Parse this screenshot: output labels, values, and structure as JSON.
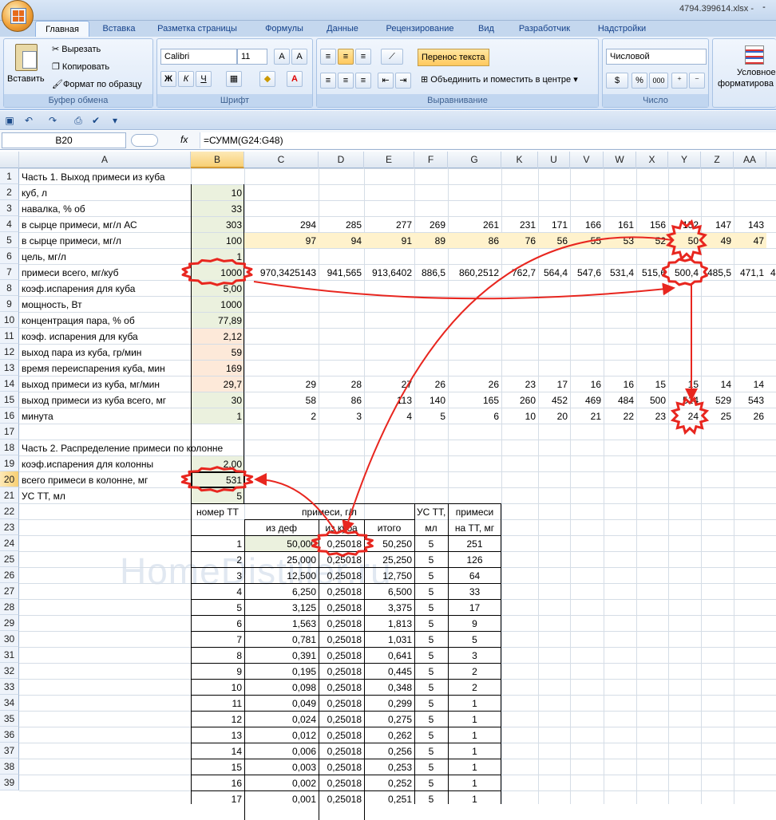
{
  "window": {
    "title": "4794.399614.xlsx - ",
    "min": "-"
  },
  "tabs": [
    "Главная",
    "Вставка",
    "Разметка страницы",
    "Формулы",
    "Данные",
    "Рецензирование",
    "Вид",
    "Разработчик",
    "Надстройки"
  ],
  "ribbon": {
    "paste": "Вставить",
    "cut": "Вырезать",
    "copy": "Копировать",
    "format_painter": "Формат по образцу",
    "clipboard_label": "Буфер обмена",
    "font_name": "Calibri",
    "font_size": "11",
    "bold": "Ж",
    "italic": "К",
    "underline": "Ч",
    "font_label": "Шрифт",
    "wrap_text": "Перенос текста",
    "merge_center": "Объединить и поместить в центре",
    "align_label": "Выравнивание",
    "number_format": "Числовой",
    "percent": "%",
    "thousands": "000",
    "number_label": "Число",
    "cond_format": "Условное",
    "cond_format2": "форматирова"
  },
  "formula_bar": {
    "name_box": "B20",
    "fx": "fx",
    "formula": "=СУММ(G24:G48)"
  },
  "columns": [
    "A",
    "B",
    "C",
    "D",
    "E",
    "F",
    "G",
    "K",
    "U",
    "V",
    "W",
    "X",
    "Y",
    "Z",
    "AA"
  ],
  "rows": [
    "1",
    "2",
    "3",
    "4",
    "5",
    "6",
    "7",
    "8",
    "9",
    "10",
    "11",
    "12",
    "13",
    "14",
    "15",
    "16",
    "17",
    "18",
    "19",
    "20",
    "21",
    "22",
    "23",
    "24",
    "25",
    "26",
    "27",
    "28",
    "29",
    "30",
    "31",
    "32",
    "33",
    "34",
    "35",
    "36",
    "37",
    "38",
    "39"
  ],
  "part1": {
    "title": "Часть 1. Выход примеси из куба",
    "labels": [
      "куб, л",
      "навалка, % об",
      "в сырце примеси, мг/л АС",
      "в сырце примеси, мг/л",
      "цель, мг/л",
      "примеси всего, мг/куб",
      "коэф.испарения для куба",
      "мощность, Вт",
      "концентрация пара, % об",
      "коэф. испарения для куба",
      "выход пара из куба, гр/мин",
      "время переиспарения куба, мин",
      "выход примеси из куба, мг/мин",
      "выход примеси из куба всего, мг",
      "минута"
    ],
    "b_values": [
      "10",
      "33",
      "303",
      "100",
      "1",
      "1000",
      "5,00",
      "1000",
      "77,89",
      "2,12",
      "59",
      "169",
      "29,7",
      "30",
      "1"
    ],
    "row4": [
      "294",
      "285",
      "277",
      "269",
      "261",
      "231",
      "171",
      "166",
      "161",
      "156",
      "152",
      "147",
      "143"
    ],
    "row5": [
      "97",
      "94",
      "91",
      "89",
      "86",
      "76",
      "56",
      "55",
      "53",
      "52",
      "50",
      "49",
      "47"
    ],
    "row7": [
      "970,3425143",
      "941,565",
      "913,6402",
      "886,5",
      "860,2512",
      "762,7",
      "564,4",
      "547,6",
      "531,4",
      "515,6",
      "500,4",
      "485,5",
      "471,1",
      "4"
    ],
    "row14": [
      "29",
      "28",
      "27",
      "26",
      "26",
      "23",
      "17",
      "16",
      "16",
      "15",
      "15",
      "14",
      "14"
    ],
    "row15": [
      "58",
      "86",
      "113",
      "140",
      "165",
      "260",
      "452",
      "469",
      "484",
      "500",
      "514",
      "529",
      "543"
    ],
    "row16": [
      "2",
      "3",
      "4",
      "5",
      "6",
      "10",
      "20",
      "21",
      "22",
      "23",
      "24",
      "25",
      "26"
    ]
  },
  "part2": {
    "title": "Часть 2. Распределение примеси по колонне",
    "labels": [
      "коэф.испарения для колонны",
      "всего примеси в колонне, мг",
      "УС ТТ, мл"
    ],
    "b_values": [
      "2,00",
      "531",
      "5"
    ],
    "headers": {
      "tt": "номер ТТ",
      "impurity": "примеси, г/л",
      "from_def": "из деф",
      "from_cube": "из куба",
      "total": "итого",
      "us_tt": "УС ТТ,",
      "us_ml": "мл",
      "imp_tt": "примеси",
      "imp_tt2": "на ТТ, мг"
    },
    "table": [
      [
        "1",
        "50,000",
        "0,25018",
        "50,250",
        "5",
        "251"
      ],
      [
        "2",
        "25,000",
        "0,25018",
        "25,250",
        "5",
        "126"
      ],
      [
        "3",
        "12,500",
        "0,25018",
        "12,750",
        "5",
        "64"
      ],
      [
        "4",
        "6,250",
        "0,25018",
        "6,500",
        "5",
        "33"
      ],
      [
        "5",
        "3,125",
        "0,25018",
        "3,375",
        "5",
        "17"
      ],
      [
        "6",
        "1,563",
        "0,25018",
        "1,813",
        "5",
        "9"
      ],
      [
        "7",
        "0,781",
        "0,25018",
        "1,031",
        "5",
        "5"
      ],
      [
        "8",
        "0,391",
        "0,25018",
        "0,641",
        "5",
        "3"
      ],
      [
        "9",
        "0,195",
        "0,25018",
        "0,445",
        "5",
        "2"
      ],
      [
        "10",
        "0,098",
        "0,25018",
        "0,348",
        "5",
        "2"
      ],
      [
        "11",
        "0,049",
        "0,25018",
        "0,299",
        "5",
        "1"
      ],
      [
        "12",
        "0,024",
        "0,25018",
        "0,275",
        "5",
        "1"
      ],
      [
        "13",
        "0,012",
        "0,25018",
        "0,262",
        "5",
        "1"
      ],
      [
        "14",
        "0,006",
        "0,25018",
        "0,256",
        "5",
        "1"
      ],
      [
        "15",
        "0,003",
        "0,25018",
        "0,253",
        "5",
        "1"
      ],
      [
        "16",
        "0,002",
        "0,25018",
        "0,252",
        "5",
        "1"
      ],
      [
        "17",
        "0,001",
        "0,25018",
        "0,251",
        "5",
        "1"
      ]
    ]
  },
  "watermark": "HomeDistiller.ru",
  "colors": {
    "accent_red": "#e8261f",
    "green_fill": "#ebf1de",
    "tan_fill": "#fde9d9",
    "yellow_fill": "#fff2cc"
  }
}
